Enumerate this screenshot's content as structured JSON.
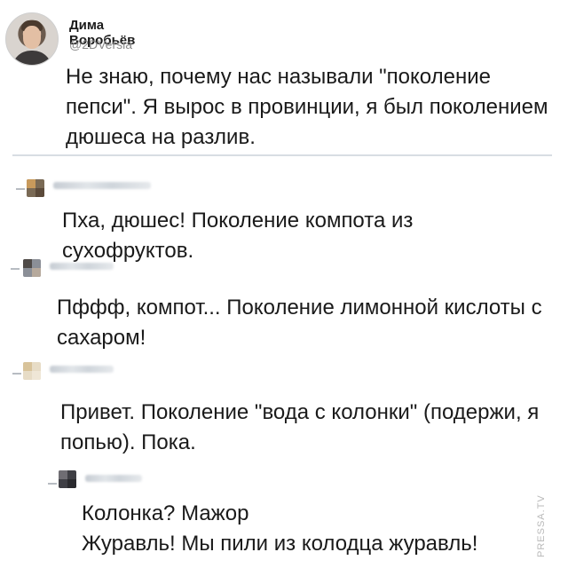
{
  "tweet": {
    "author_name": "Дима Воробьёв",
    "author_handle": "@2DVersia",
    "text": "Не знаю, почему нас называли \"поколение пепси\". Я вырос в провинции, я был поколением дюшеса на разлив."
  },
  "replies": [
    {
      "text": "Пха, дюшес! Поколение компота из сухофруктов."
    },
    {
      "text": "Пффф, компот... Поколение лимонной кислоты с сахаром!"
    },
    {
      "text": "Привет. Поколение \"вода с колонки\" (подержи, я попью). Пока."
    },
    {
      "text": "Колонка? Мажор\nЖуравль! Мы пили из колодца журавль!"
    }
  ],
  "watermark": "PRESSA.TV",
  "colors": {
    "text": "#1a1a1a",
    "handle": "#8a8a8a",
    "divider": "#d8dde3"
  }
}
